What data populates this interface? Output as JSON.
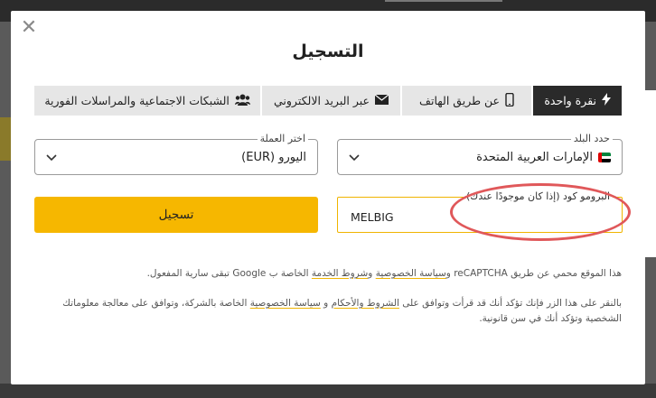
{
  "modal": {
    "close_icon": "✕",
    "title": "التسجيل"
  },
  "tabs": [
    {
      "label": "نقرة واحدة",
      "icon": "bolt-icon",
      "active": true
    },
    {
      "label": "عن طريق الهاتف",
      "icon": "phone-icon",
      "active": false
    },
    {
      "label": "عبر البريد الالكتروني",
      "icon": "envelope-icon",
      "active": false
    },
    {
      "label": "الشبكات الاجتماعية والمراسلات الفورية",
      "icon": "users-icon",
      "active": false
    }
  ],
  "country": {
    "legend": "حدد البلد",
    "value": "الإمارات العربية المتحدة",
    "flag": "uae-flag"
  },
  "currency": {
    "legend": "اختر العملة",
    "value": "اليورو (EUR)"
  },
  "promo": {
    "legend": "البرومو كود (إذا كان موجودًا عندك)",
    "value": "MELBIG"
  },
  "register_button": {
    "label": "تسجيل"
  },
  "legal1": {
    "prefix": "هذا الموقع محمي عن طريق reCAPTCHA و",
    "privacy_link": "سياسة الخصوصية",
    "and": " و",
    "terms_link": "شروط الخدمة",
    "suffix": " الخاصة ب Google تبقى سارية المفعول."
  },
  "legal2": {
    "prefix": "بالنقر على هذا الزر فإنك تؤكد أنك قد قرأت وتوافق على ",
    "terms_link": "الشروط والأحكام",
    "and": " و ",
    "privacy_link": "سياسة الخصوصية",
    "suffix": " الخاصة بالشركة، وتوافق على معالجة معلوماتك الشخصية وتؤكد أنك في سن قانونية."
  },
  "colors": {
    "accent": "#f6b700",
    "highlight": "#e0585a",
    "tab_active": "#2a2a2a"
  }
}
